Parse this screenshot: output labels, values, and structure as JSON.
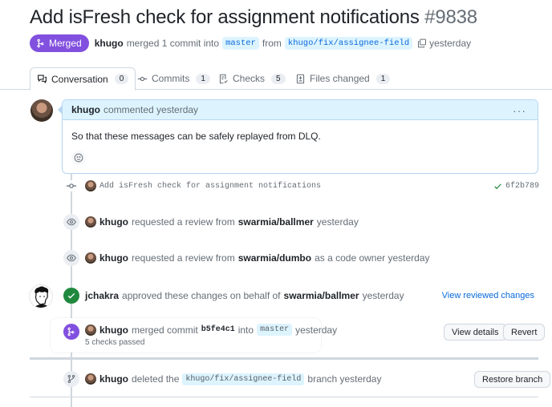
{
  "header": {
    "title": "Add isFresh check for assignment notifications",
    "number": "#9838",
    "status_badge": "Merged",
    "author": "khugo",
    "merge_text": "merged 1 commit into",
    "base_branch": "master",
    "from_text": "from",
    "head_branch": "khugo/fix/assignee-field",
    "time": "yesterday"
  },
  "tabs": [
    {
      "label": "Conversation",
      "count": "0",
      "icon": "comment-discussion-icon",
      "active": true
    },
    {
      "label": "Commits",
      "count": "1",
      "icon": "git-commit-icon",
      "active": false
    },
    {
      "label": "Checks",
      "count": "5",
      "icon": "checklist-icon",
      "active": false
    },
    {
      "label": "Files changed",
      "count": "1",
      "icon": "file-diff-icon",
      "active": false
    }
  ],
  "comment": {
    "author": "khugo",
    "action": "commented yesterday",
    "body": "So that these messages can be safely replayed from DLQ.",
    "menu": "···"
  },
  "timeline": {
    "commit": {
      "message": "Add isFresh check for assignment notifications",
      "sha": "6f2b789"
    },
    "review_request_1": {
      "author": "khugo",
      "text": "requested a review from",
      "reviewer": "swarmia/ballmer",
      "time": "yesterday"
    },
    "review_request_2": {
      "author": "khugo",
      "text": "requested a review from",
      "reviewer": "swarmia/dumbo",
      "suffix": "as a code owner yesterday"
    },
    "approval": {
      "author": "jchakra",
      "text": "approved these changes on behalf of",
      "team": "swarmia/ballmer",
      "time": "yesterday",
      "link": "View reviewed changes"
    },
    "merge": {
      "author": "khugo",
      "text": "merged commit",
      "sha": "b5fe4c1",
      "into": "into",
      "branch": "master",
      "time": "yesterday",
      "checks": "5 checks passed",
      "view_details": "View details",
      "revert": "Revert"
    },
    "branch_deleted": {
      "author": "khugo",
      "text": "deleted the",
      "branch": "khugo/fix/assignee-field",
      "suffix": "branch yesterday",
      "restore": "Restore branch"
    }
  },
  "colors": {
    "merged": "#8250df",
    "approved": "#1f883d",
    "link": "#0969da"
  }
}
